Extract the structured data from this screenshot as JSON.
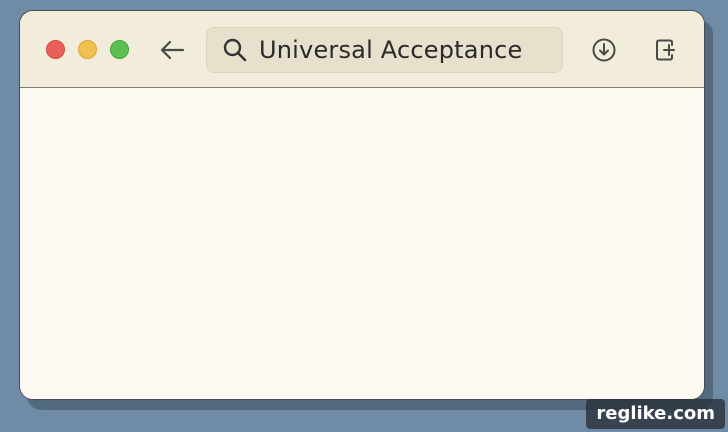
{
  "window": {
    "traffic_lights": [
      {
        "name": "close",
        "color": "#e9605a"
      },
      {
        "name": "minimize",
        "color": "#f1c04f"
      },
      {
        "name": "zoom",
        "color": "#5cbf4f"
      }
    ]
  },
  "toolbar": {
    "back_icon": "arrow-left-icon",
    "address": {
      "icon": "search-icon",
      "value": "Universal Acceptance"
    },
    "download_icon": "download-circle-icon",
    "new_tab_icon": "new-tab-icon"
  },
  "watermark": {
    "text": "reglike.com"
  },
  "colors": {
    "desktop_background": "#6f8ba6",
    "toolbar_background": "#f2ecdb",
    "content_background": "#fcf9f2",
    "address_bar_background": "#e7e0cd"
  }
}
